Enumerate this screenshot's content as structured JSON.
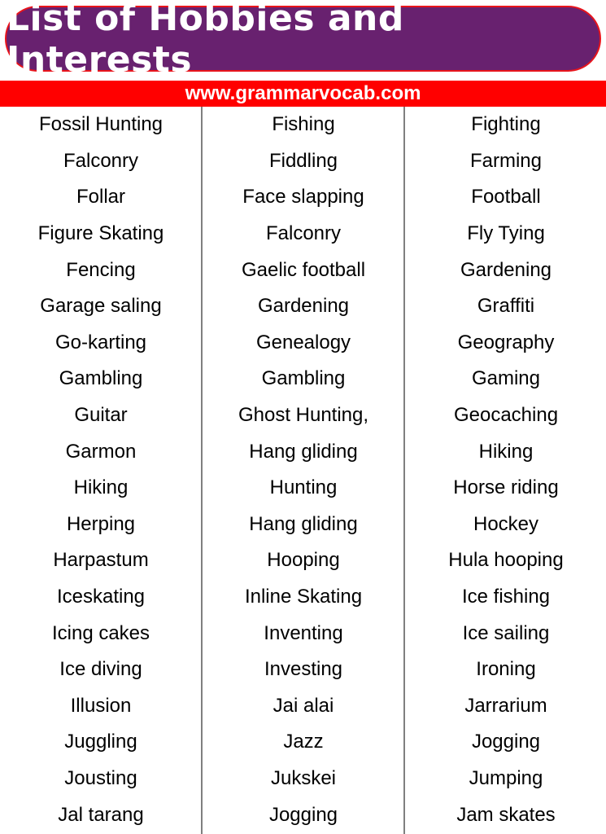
{
  "header": {
    "title": "List of Hobbies and Interests",
    "url": "www.grammarvocab.com"
  },
  "colors": {
    "title_bg": "#68216F",
    "title_border": "#e8141c",
    "url_bar_bg": "#ff0000",
    "text": "#000000",
    "divider": "#7f7f7f"
  },
  "columns": [
    [
      "Fossil Hunting",
      "Falconry",
      "Follar",
      "Figure Skating",
      "Fencing",
      "Garage saling",
      "Go-karting",
      "Gambling",
      "Guitar",
      "Garmon",
      "Hiking",
      "Herping",
      "Harpastum",
      "Iceskating",
      "Icing cakes",
      "Ice diving",
      "Illusion",
      "Juggling",
      "Jousting",
      "Jal tarang"
    ],
    [
      "Fishing",
      "Fiddling",
      "Face slapping",
      "Falconry",
      "Gaelic football",
      "Gardening",
      "Genealogy",
      "Gambling",
      "Ghost Hunting,",
      "Hang gliding",
      "Hunting",
      "Hang gliding",
      "Hooping",
      "Inline Skating",
      "Inventing",
      "Investing",
      "Jai alai",
      "Jazz",
      "Jukskei",
      "Jogging"
    ],
    [
      "Fighting",
      "Farming",
      "Football",
      "Fly Tying",
      "Gardening",
      "Graffiti",
      "Geography",
      "Gaming",
      "Geocaching",
      "Hiking",
      "Horse riding",
      "Hockey",
      "Hula hooping",
      "Ice fishing",
      "Ice sailing",
      "Ironing",
      "Jarrarium",
      "Jogging",
      "Jumping",
      "Jam skates"
    ]
  ]
}
